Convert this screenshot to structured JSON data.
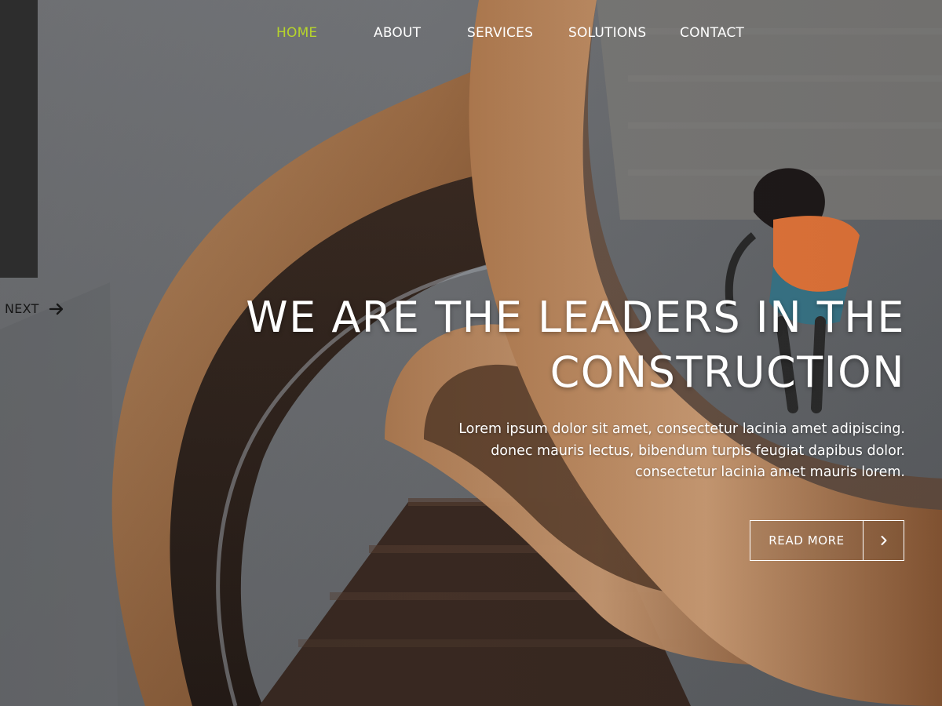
{
  "colors": {
    "accent": "#b6d42c",
    "text_light": "#ffffff",
    "panel_dark": "#2d2d2d"
  },
  "nav": {
    "items": [
      {
        "label": "HOME",
        "active": true
      },
      {
        "label": "ABOUT",
        "active": false
      },
      {
        "label": "SERVICES",
        "active": false
      },
      {
        "label": "SOLUTIONS",
        "active": false
      },
      {
        "label": "CONTACT",
        "active": false
      }
    ]
  },
  "slider": {
    "next_label": "NEXT",
    "next_icon": "arrow-right-icon"
  },
  "hero": {
    "headline_lines": [
      "WE ARE THE LEADERS IN THE",
      "CONSTRUCTION"
    ],
    "subtext_lines": [
      "Lorem ipsum dolor sit amet, consectetur lacinia amet adipiscing.",
      "donec mauris lectus, bibendum turpis feugiat dapibus dolor.",
      "consectetur lacinia amet mauris lorem."
    ],
    "cta_label": "READ MORE",
    "cta_icon": "chevron-right-icon"
  }
}
